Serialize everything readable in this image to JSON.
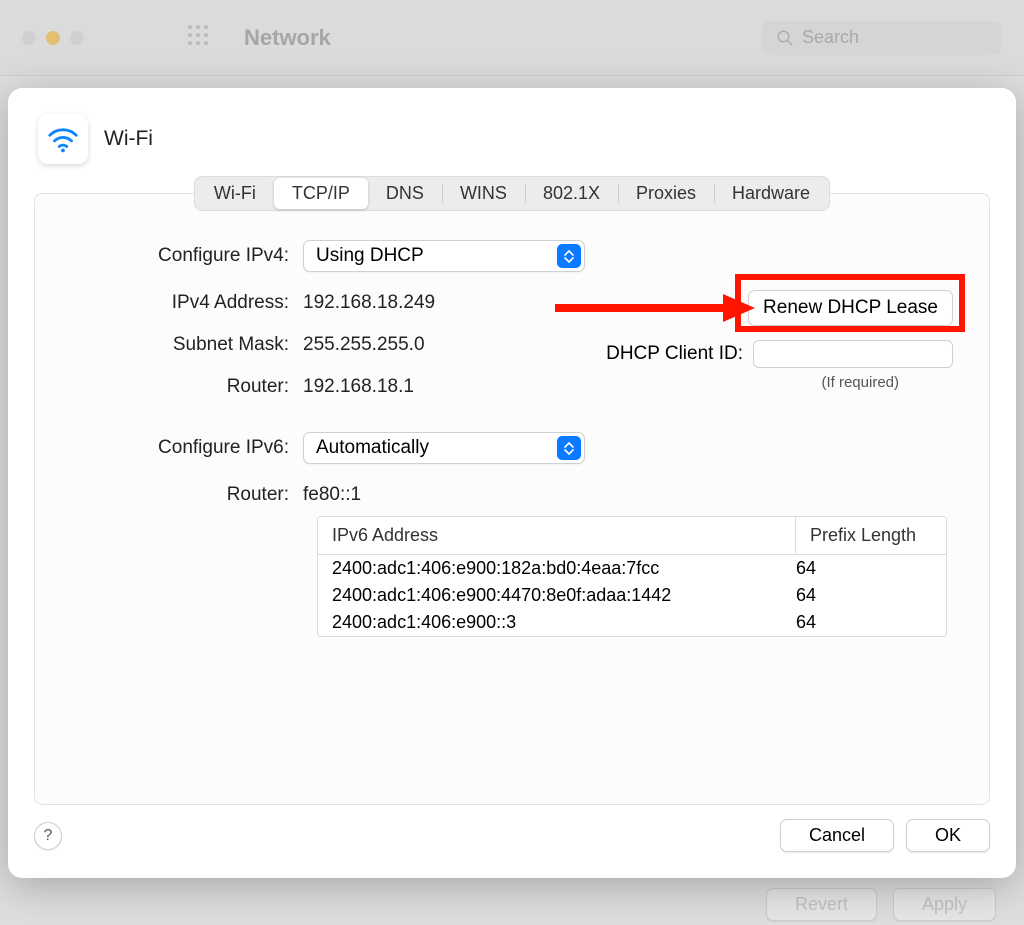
{
  "window": {
    "title": "Network",
    "search_placeholder": "Search"
  },
  "sheet": {
    "title": "Wi-Fi",
    "tabs": [
      "Wi-Fi",
      "TCP/IP",
      "DNS",
      "WINS",
      "802.1X",
      "Proxies",
      "Hardware"
    ],
    "active_tab": "TCP/IP"
  },
  "ipv4": {
    "configure_label": "Configure IPv4:",
    "configure_value": "Using DHCP",
    "address_label": "IPv4 Address:",
    "address_value": "192.168.18.249",
    "subnet_label": "Subnet Mask:",
    "subnet_value": "255.255.255.0",
    "router_label": "Router:",
    "router_value": "192.168.18.1",
    "renew_label": "Renew DHCP Lease",
    "dhcp_client_label": "DHCP Client ID:",
    "dhcp_client_value": "",
    "if_required": "(If required)"
  },
  "ipv6": {
    "configure_label": "Configure IPv6:",
    "configure_value": "Automatically",
    "router_label": "Router:",
    "router_value": "fe80::1",
    "table": {
      "col1": "IPv6 Address",
      "col2": "Prefix Length",
      "rows": [
        {
          "addr": "2400:adc1:406:e900:182a:bd0:4eaa:7fcc",
          "prefix": "64"
        },
        {
          "addr": "2400:adc1:406:e900:4470:8e0f:adaa:1442",
          "prefix": "64"
        },
        {
          "addr": "2400:adc1:406:e900::3",
          "prefix": "64"
        }
      ]
    }
  },
  "footer": {
    "help": "?",
    "cancel": "Cancel",
    "ok": "OK"
  },
  "background_footer": {
    "revert": "Revert",
    "apply": "Apply"
  }
}
